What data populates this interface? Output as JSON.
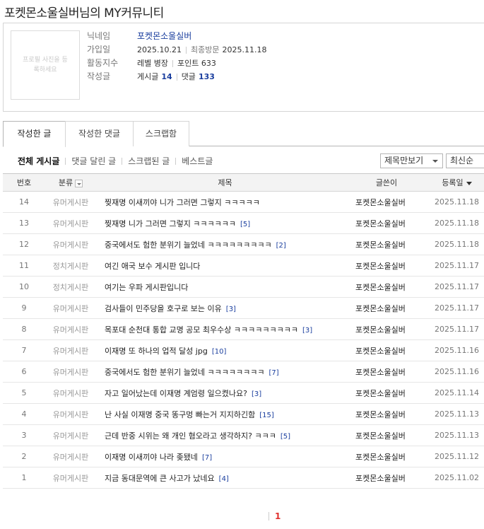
{
  "page_title": "포켓몬소울실버님의 MY커뮤니티",
  "profile": {
    "photo_placeholder": "프로필 사진을 등록하세요",
    "nickname_label": "닉네임",
    "nickname": "포켓몬소울실버",
    "joined_label": "가입일",
    "joined": "2025.10.21",
    "last_visit_label": "최종방문",
    "last_visit": "2025.11.18",
    "activity_label": "활동지수",
    "level": "레벨 병장",
    "point": "포인트 633",
    "posts_label": "작성글",
    "post_count_label": "게시글",
    "post_count": "14",
    "comment_count_label": "댓글",
    "comment_count": "133"
  },
  "tabs": [
    {
      "label": "작성한 글",
      "active": true
    },
    {
      "label": "작성한 댓글",
      "active": false
    },
    {
      "label": "스크랩함",
      "active": false
    }
  ],
  "filters": [
    {
      "label": "전체 게시글",
      "active": true
    },
    {
      "label": "댓글 달린 글",
      "active": false
    },
    {
      "label": "스크랩된 글",
      "active": false
    },
    {
      "label": "베스트글",
      "active": false
    }
  ],
  "view_select": "제목만보기",
  "sort_select": "최신순",
  "columns": {
    "num": "번호",
    "category": "분류",
    "title": "제목",
    "writer": "글쓴이",
    "date": "등록일"
  },
  "rows": [
    {
      "num": "14",
      "category": "유머게시판",
      "title": "찢재명 이새끼야 니가 그러면 그렇지 ㅋㅋㅋㅋㅋ",
      "comments": "",
      "writer": "포켓몬소울실버",
      "date": "2025.11.18"
    },
    {
      "num": "13",
      "category": "유머게시판",
      "title": "찢재명 니가 그러면 그렇지 ㅋㅋㅋㅋㅋㅋ",
      "comments": "[5]",
      "writer": "포켓몬소울실버",
      "date": "2025.11.18"
    },
    {
      "num": "12",
      "category": "유머게시판",
      "title": "중국에서도 험한 분위기 늘었네 ㅋㅋㅋㅋㅋㅋㅋㅋㅋ",
      "comments": "[2]",
      "writer": "포켓몬소울실버",
      "date": "2025.11.18"
    },
    {
      "num": "11",
      "category": "정치게시판",
      "title": "여긴 애국 보수 게시판 입니다",
      "comments": "",
      "writer": "포켓몬소울실버",
      "date": "2025.11.17"
    },
    {
      "num": "10",
      "category": "정치게시판",
      "title": "여기는 우파 게시판입니다",
      "comments": "",
      "writer": "포켓몬소울실버",
      "date": "2025.11.17"
    },
    {
      "num": "9",
      "category": "유머게시판",
      "title": "검사들이 민주당을 호구로 보는 이유",
      "comments": "[3]",
      "writer": "포켓몬소울실버",
      "date": "2025.11.17"
    },
    {
      "num": "8",
      "category": "유머게시판",
      "title": "목포대 순천대 통합 교명 공모 최우수상 ㅋㅋㅋㅋㅋㅋㅋㅋㅋ",
      "comments": "[3]",
      "writer": "포켓몬소울실버",
      "date": "2025.11.17"
    },
    {
      "num": "7",
      "category": "유머게시판",
      "title": "이재명 또 하나의 업적 달성 jpg",
      "comments": "[10]",
      "writer": "포켓몬소울실버",
      "date": "2025.11.16"
    },
    {
      "num": "6",
      "category": "유머게시판",
      "title": "중국에서도 험한 분위기 늘었네 ㅋㅋㅋㅋㅋㅋㅋㅋ",
      "comments": "[7]",
      "writer": "포켓몬소울실버",
      "date": "2025.11.16"
    },
    {
      "num": "5",
      "category": "유머게시판",
      "title": "자고 일어났는데 이재명 계엄령 일으켰나요?",
      "comments": "[3]",
      "writer": "포켓몬소울실버",
      "date": "2025.11.14"
    },
    {
      "num": "4",
      "category": "유머게시판",
      "title": "난 사실 이재명 중국 똥구멍 빠는거 지지하긴함",
      "comments": "[15]",
      "writer": "포켓몬소울실버",
      "date": "2025.11.13"
    },
    {
      "num": "3",
      "category": "유머게시판",
      "title": "근데 반중 시위는 왜 개인 혐오라고 생각하지? ㅋㅋㅋ",
      "comments": "[5]",
      "writer": "포켓몬소울실버",
      "date": "2025.11.13"
    },
    {
      "num": "2",
      "category": "유머게시판",
      "title": "이재명 이새끼야 나라 좆됐네",
      "comments": "[7]",
      "writer": "포켓몬소울실버",
      "date": "2025.11.12"
    },
    {
      "num": "1",
      "category": "유머게시판",
      "title": "지금 동대문역에 큰 사고가 났네요",
      "comments": "[4]",
      "writer": "포켓몬소울실버",
      "date": "2025.11.02"
    }
  ],
  "pagination": {
    "current": "1"
  }
}
